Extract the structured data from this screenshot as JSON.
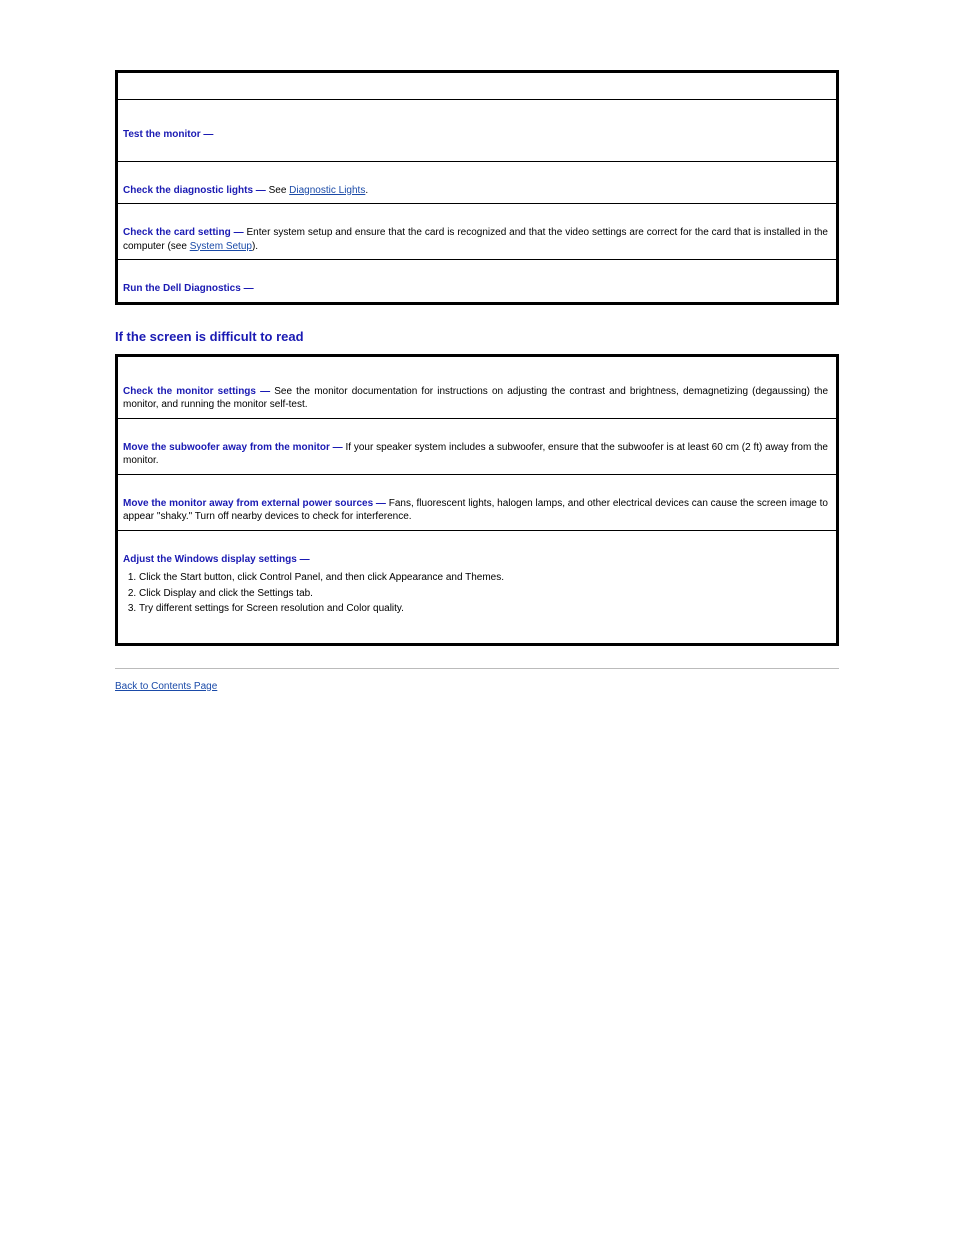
{
  "row1": {
    "l1": "",
    "l2": ""
  },
  "row2": {
    "hdr": "Test the monitor —",
    "l1": "",
    "l2": ""
  },
  "row3": {
    "hdr": "Check the diagnostic lights —",
    "pre": "See ",
    "link": "Diagnostic Lights",
    "post": "."
  },
  "row4": {
    "hdr": "Check the card setting —",
    "l1": "Enter system setup and ensure that the card is recognized and that the video settings are correct for the card that is installed in the computer (see ",
    "link": "System Setup",
    "l1b": ")."
  },
  "row5": {
    "hdr": "Run the Dell Diagnostics ",
    "dash": "—",
    "l1": "",
    "l2": ""
  },
  "section_heading": "If the screen is difficult to read",
  "b1": {
    "hdr": "Check the monitor settings —",
    "l1": "See the monitor documentation for instructions on adjusting the contrast and brightness, demagnetizing (degaussing) the monitor, and running the monitor self-test."
  },
  "b2": {
    "hdr": "Move the subwoofer away from the monitor —",
    "body": "If your speaker system includes a subwoofer, ensure that the subwoofer is at least 60 cm (2 ft) away from the monitor."
  },
  "b3": {
    "hdr": "Move the monitor away from external power sources —",
    "l1": "Fans, fluorescent lights, halogen lamps, and other electrical devices can cause the screen image to appear \"shaky.\" Turn off nearby devices to check for interference."
  },
  "b4": {
    "hdr": "Adjust the Windows display settings —",
    "li1": "Click the Start button, click Control Panel, and then click Appearance and Themes.",
    "li2": "Click Display and click the Settings tab.",
    "li3": "Try different settings for Screen resolution and Color quality."
  },
  "back": "Back to Contents Page"
}
